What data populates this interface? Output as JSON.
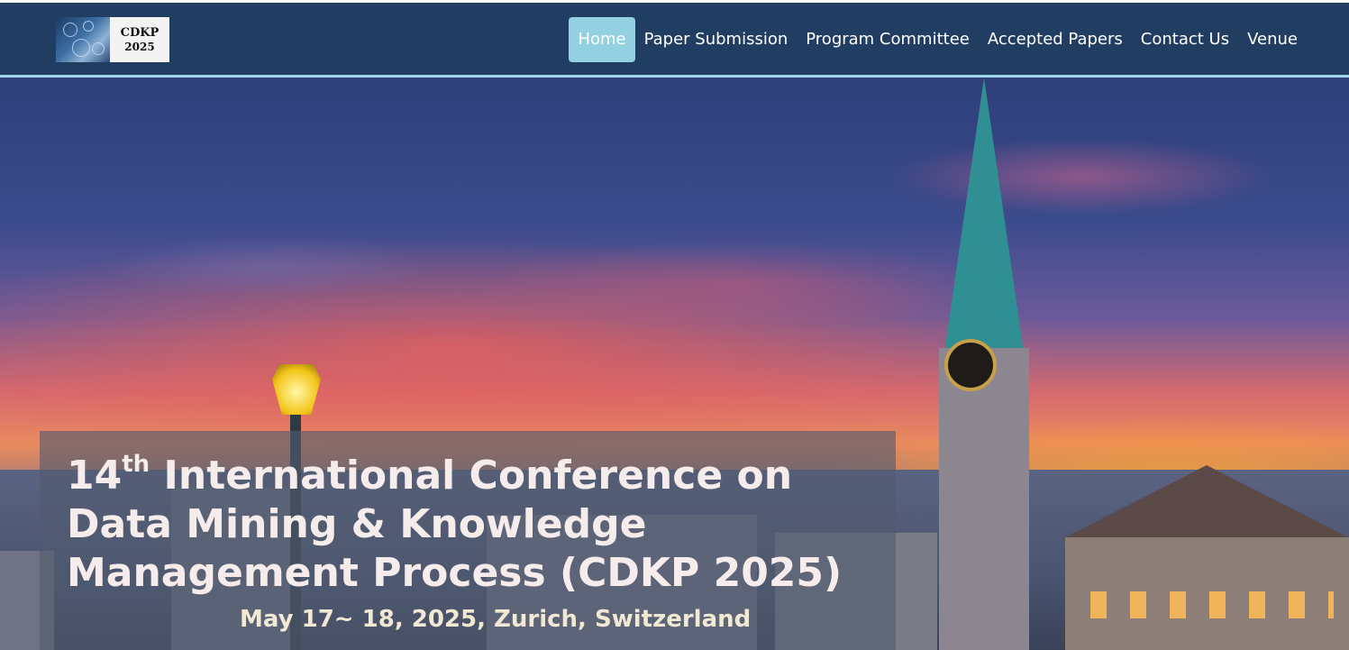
{
  "logo": {
    "line1": "CDKP",
    "line2": "2025"
  },
  "nav": {
    "items": [
      {
        "label": "Home",
        "active": true
      },
      {
        "label": "Paper Submission",
        "active": false
      },
      {
        "label": "Program Committee",
        "active": false
      },
      {
        "label": "Accepted Papers",
        "active": false
      },
      {
        "label": "Contact Us",
        "active": false
      },
      {
        "label": "Venue",
        "active": false
      }
    ]
  },
  "hero": {
    "title_ordinal": "14",
    "title_suffix": "th",
    "title_rest": " International Conference on Data Mining & Knowledge Management Process (CDKP 2025)",
    "date_location": "May 17~ 18, 2025, Zurich, Switzerland"
  },
  "colors": {
    "navbar": "#213e62",
    "active_tab": "#93d1e2",
    "nav_border": "#9dd6e6"
  }
}
